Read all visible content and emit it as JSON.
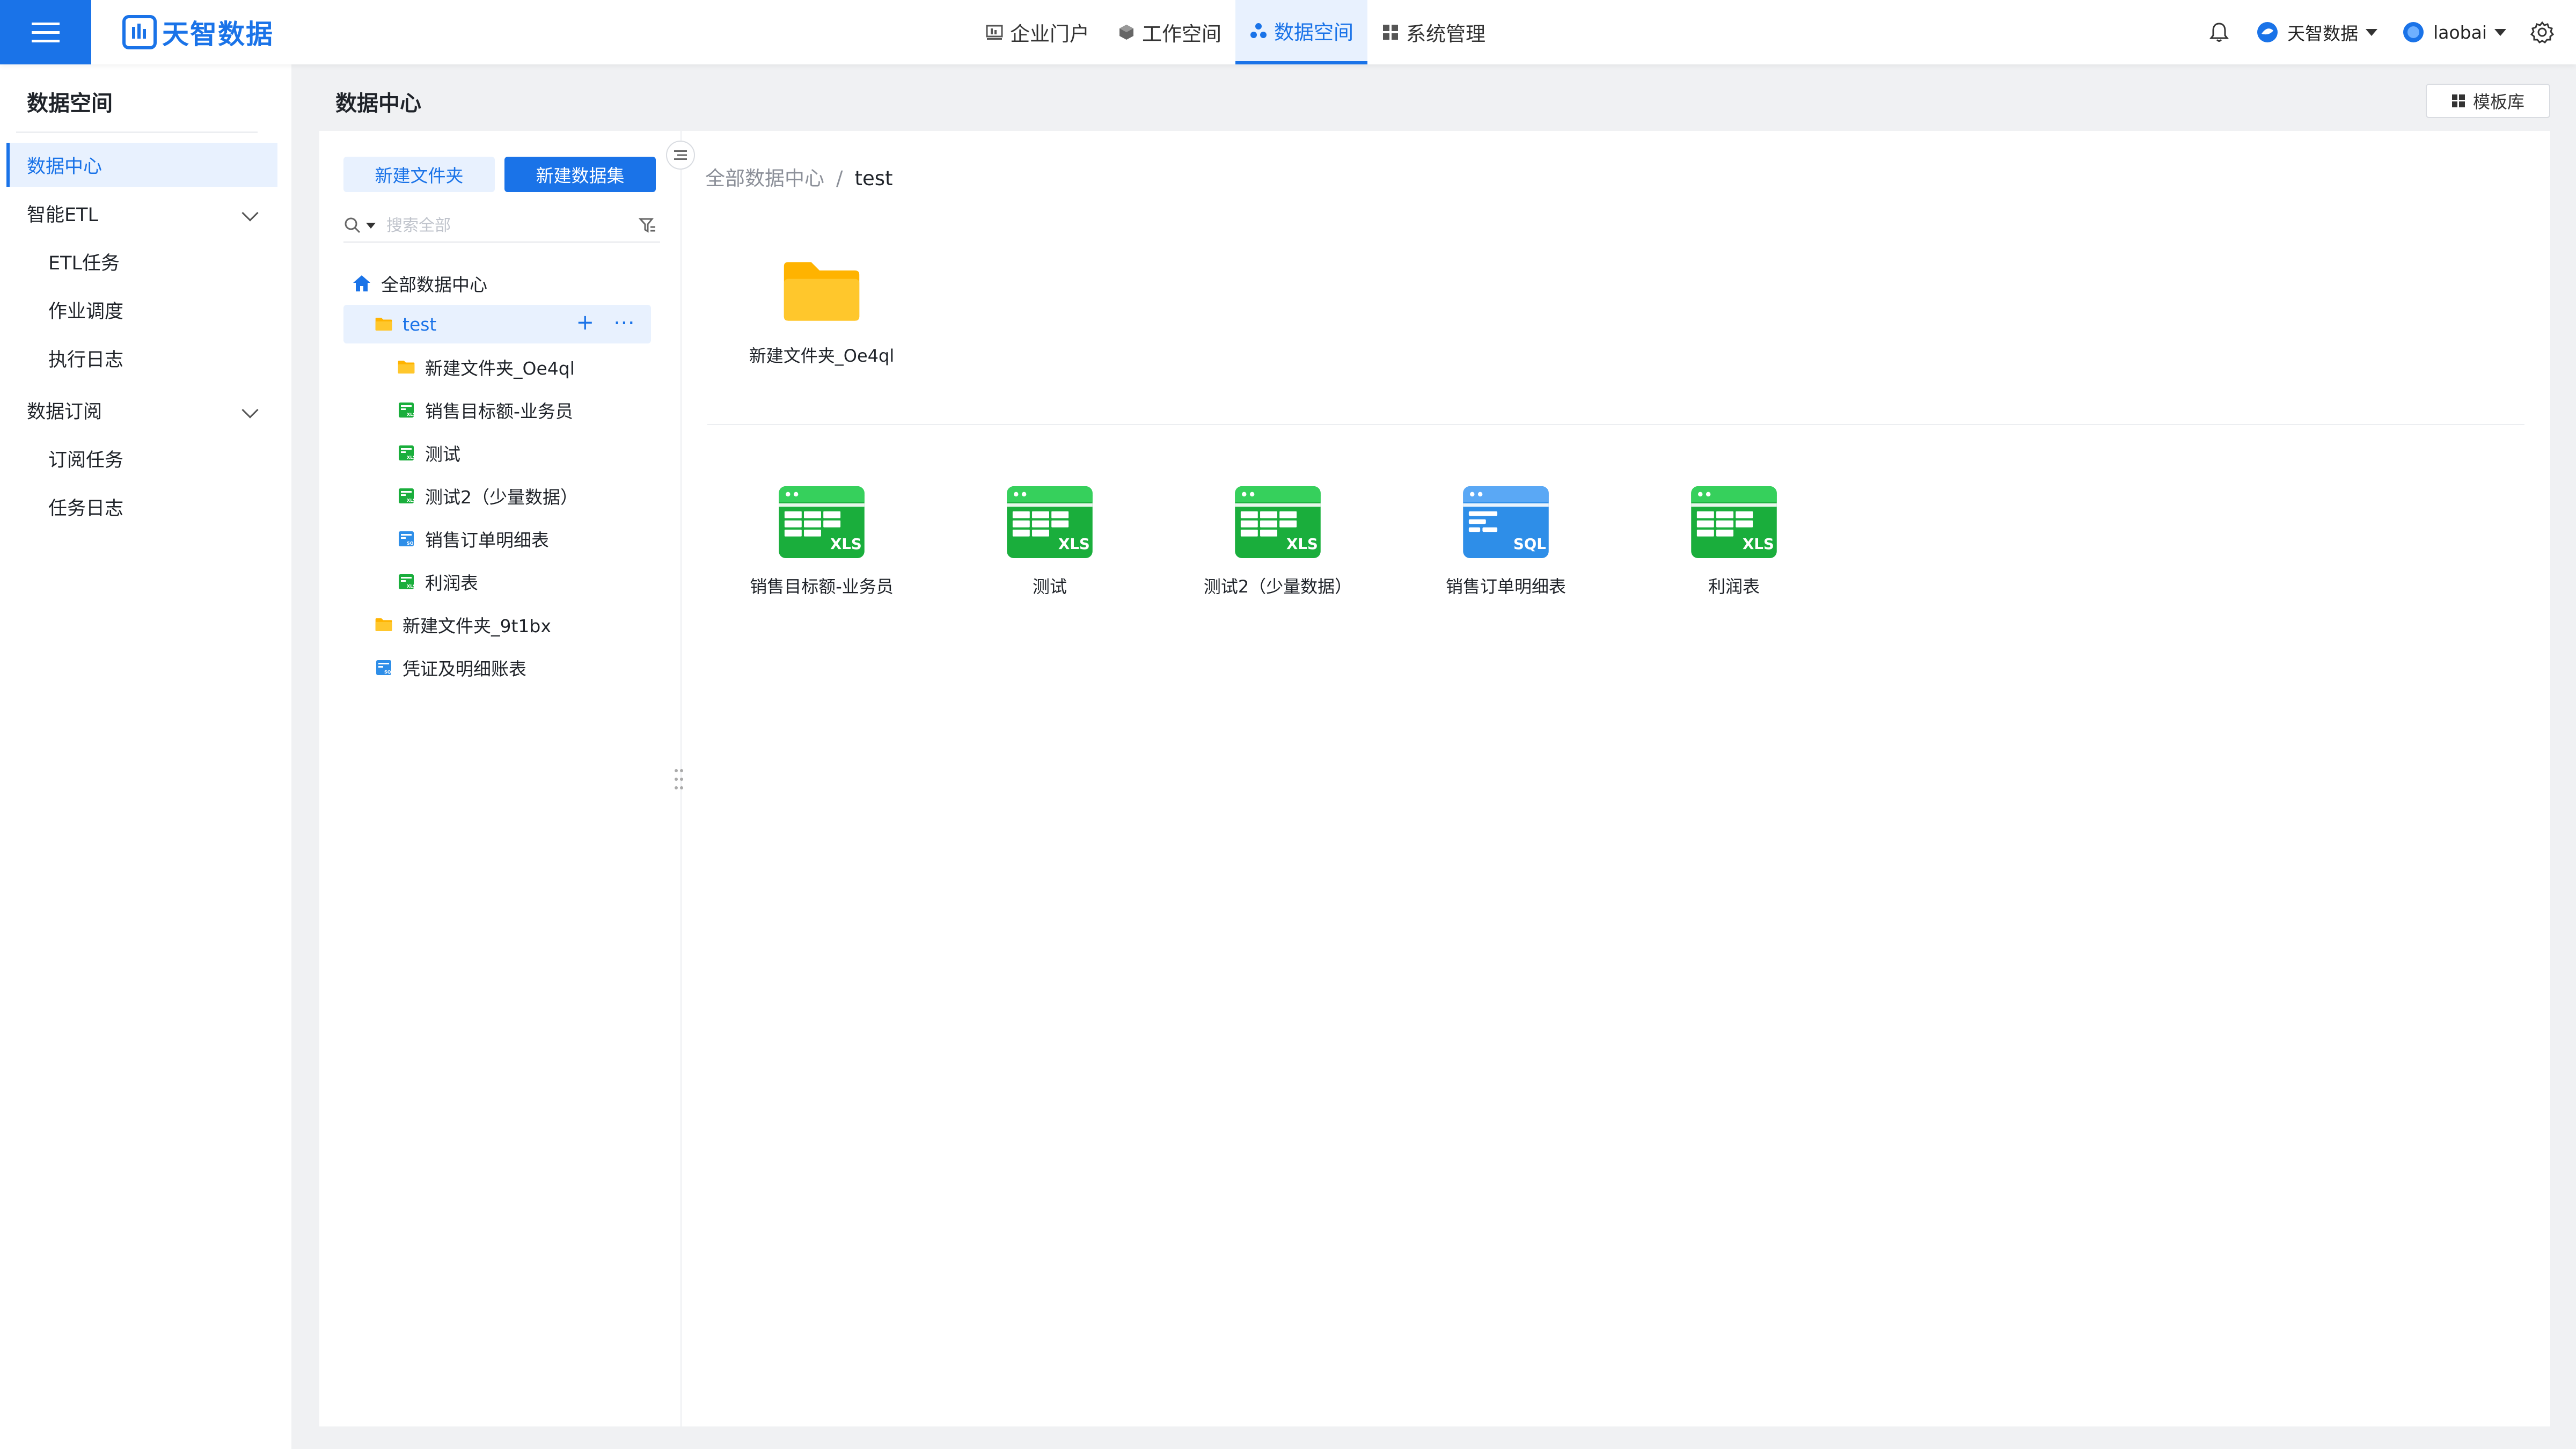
{
  "app": {
    "logo_text": "天智数据"
  },
  "nav": [
    {
      "label": "企业门户",
      "icon": "portal-icon"
    },
    {
      "label": "工作空间",
      "icon": "cube-icon"
    },
    {
      "label": "数据空间",
      "icon": "data-space-icon",
      "active": true
    },
    {
      "label": "系统管理",
      "icon": "grid-icon"
    }
  ],
  "topright": {
    "org": "天智数据",
    "user": "laobai"
  },
  "sidebar": {
    "title": "数据空间",
    "items": [
      {
        "label": "数据中心",
        "active": true
      },
      {
        "label": "智能ETL",
        "expandable": true
      },
      {
        "label": "ETL任务"
      },
      {
        "label": "作业调度"
      },
      {
        "label": "执行日志"
      },
      {
        "label": "数据订阅",
        "expandable": true
      },
      {
        "label": "订阅任务"
      },
      {
        "label": "任务日志"
      }
    ]
  },
  "main": {
    "title": "数据中心",
    "template_btn": "模板库",
    "new_folder": "新建文件夹",
    "new_dataset": "新建数据集",
    "search_placeholder": "搜索全部",
    "tree": {
      "root": "全部数据中心",
      "items": [
        {
          "label": "test",
          "type": "folder",
          "level": 1,
          "selected": true
        },
        {
          "label": "新建文件夹_Oe4ql",
          "type": "folder",
          "level": 2
        },
        {
          "label": "销售目标额-业务员",
          "type": "xls",
          "level": 2
        },
        {
          "label": "测试",
          "type": "xls",
          "level": 2
        },
        {
          "label": "测试2（少量数据）",
          "type": "xls",
          "level": 2
        },
        {
          "label": "销售订单明细表",
          "type": "sql",
          "level": 2
        },
        {
          "label": "利润表",
          "type": "xls",
          "level": 2
        },
        {
          "label": "新建文件夹_9t1bx",
          "type": "folder",
          "level": 1
        },
        {
          "label": "凭证及明细账表",
          "type": "sql",
          "level": 1
        }
      ]
    },
    "breadcrumb": {
      "root": "全部数据中心",
      "sep": "/",
      "current": "test"
    },
    "folders": [
      {
        "label": "新建文件夹_Oe4ql"
      }
    ],
    "files": [
      {
        "label": "销售目标额-业务员",
        "type": "xls",
        "badge": "XLS"
      },
      {
        "label": "测试",
        "type": "xls",
        "badge": "XLS"
      },
      {
        "label": "测试2（少量数据）",
        "type": "xls",
        "badge": "XLS"
      },
      {
        "label": "销售订单明细表",
        "type": "sql",
        "badge": "SQL"
      },
      {
        "label": "利润表",
        "type": "xls",
        "badge": "XLS"
      }
    ]
  },
  "colors": {
    "accent": "#1a73e8",
    "xls": "#1aae3c",
    "sql": "#2e8ee8",
    "folder": "#ffb300"
  }
}
